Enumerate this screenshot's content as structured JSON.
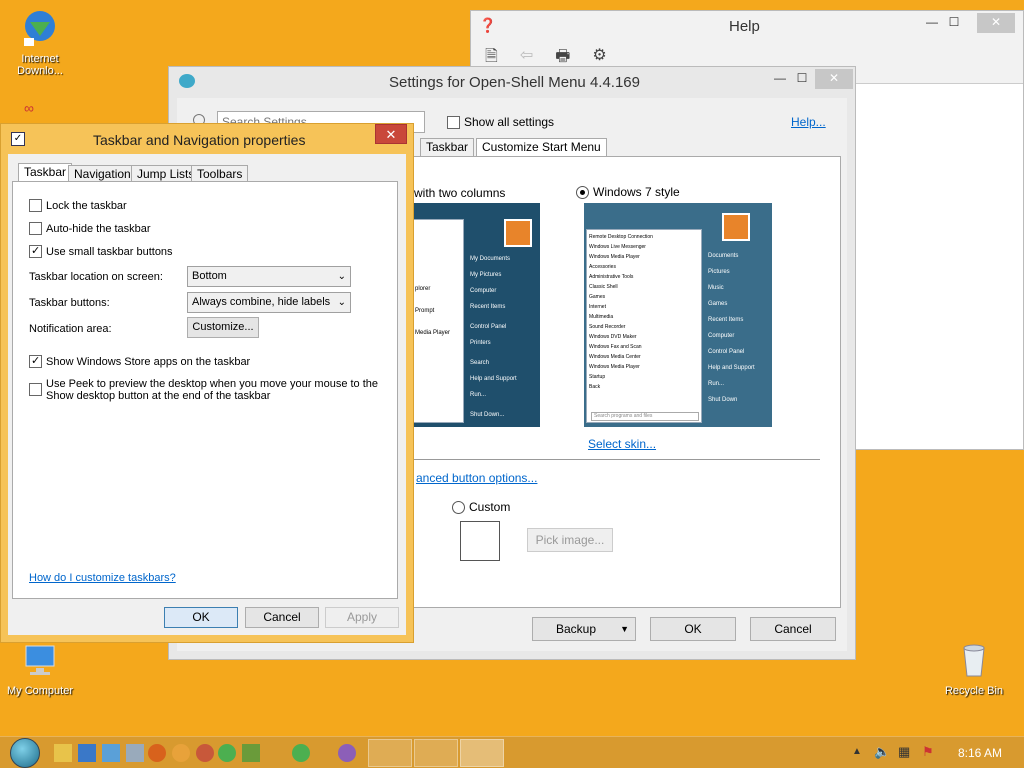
{
  "desktop": {
    "icons": [
      {
        "label": "Internet Downlo...",
        "icon": "internet-download-manager-icon"
      },
      {
        "label": "My Computer",
        "icon": "computer-icon"
      },
      {
        "label": "Recycle Bin",
        "icon": "recycle-bin-icon"
      }
    ]
  },
  "help_window": {
    "title": "Help",
    "toolbar": [
      "contents-icon",
      "back-icon",
      "print-icon",
      "options-icon"
    ]
  },
  "settings_window": {
    "title": "Settings for Open-Shell Menu 4.4.169",
    "search_placeholder": "Search Settings",
    "show_all_label": "Show all settings",
    "help_link": "Help...",
    "tabs": [
      "Taskbar",
      "Customize Start Menu"
    ],
    "style_two_columns_label": "with two columns",
    "style_win7_label": "Windows 7 style",
    "select_skin_link": "Select skin...",
    "advanced_link": "anced button options...",
    "custom_label": "Custom",
    "pick_image_label": "Pick image...",
    "backup_label": "Backup",
    "ok_label": "OK",
    "cancel_label": "Cancel",
    "preview_two_col_right": [
      "My Documents",
      "My Pictures",
      "Computer",
      "Recent Items",
      "Control Panel",
      "Printers",
      "Search",
      "Help and Support",
      "Run...",
      "Shut Down..."
    ],
    "preview_two_col_left": [
      "plorer",
      "Prompt",
      "Media Player"
    ],
    "preview_win7_left": [
      "Remote Desktop Connection",
      "Windows Live Messenger",
      "Windows Media Player",
      "Accessories",
      "Administrative Tools",
      "Classic Shell",
      "Games",
      "Internet",
      "Multimedia",
      "Sound Recorder",
      "Windows DVD Maker",
      "Windows Fax and Scan",
      "Windows Media Center",
      "Windows Media Player",
      "Startup",
      "Back"
    ],
    "preview_win7_search": "Search programs and files",
    "preview_win7_right": [
      "Documents",
      "Pictures",
      "Music",
      "Games",
      "Recent Items",
      "Computer",
      "Control Panel",
      "Help and Support",
      "Run...",
      "Shut Down"
    ]
  },
  "taskbar_dialog": {
    "title": "Taskbar and Navigation properties",
    "tabs": [
      "Taskbar",
      "Navigation",
      "Jump Lists",
      "Toolbars"
    ],
    "lock_label": "Lock the taskbar",
    "autohide_label": "Auto-hide the taskbar",
    "small_buttons_label": "Use small taskbar buttons",
    "location_label": "Taskbar location on screen:",
    "location_value": "Bottom",
    "buttons_label": "Taskbar buttons:",
    "buttons_value": "Always combine, hide labels",
    "notification_label": "Notification area:",
    "customize_label": "Customize...",
    "store_apps_label": "Show Windows Store apps on the taskbar",
    "peek_label_1": "Use Peek to preview the desktop when you move your mouse to the",
    "peek_label_2": "Show desktop button at the end of the taskbar",
    "how_link": "How do I customize taskbars?",
    "ok_label": "OK",
    "cancel_label": "Cancel",
    "apply_label": "Apply",
    "checked": {
      "lock": false,
      "autohide": false,
      "small_buttons": true,
      "store_apps": true,
      "peek": false
    }
  },
  "taskbar": {
    "clock": "8:16 AM"
  }
}
